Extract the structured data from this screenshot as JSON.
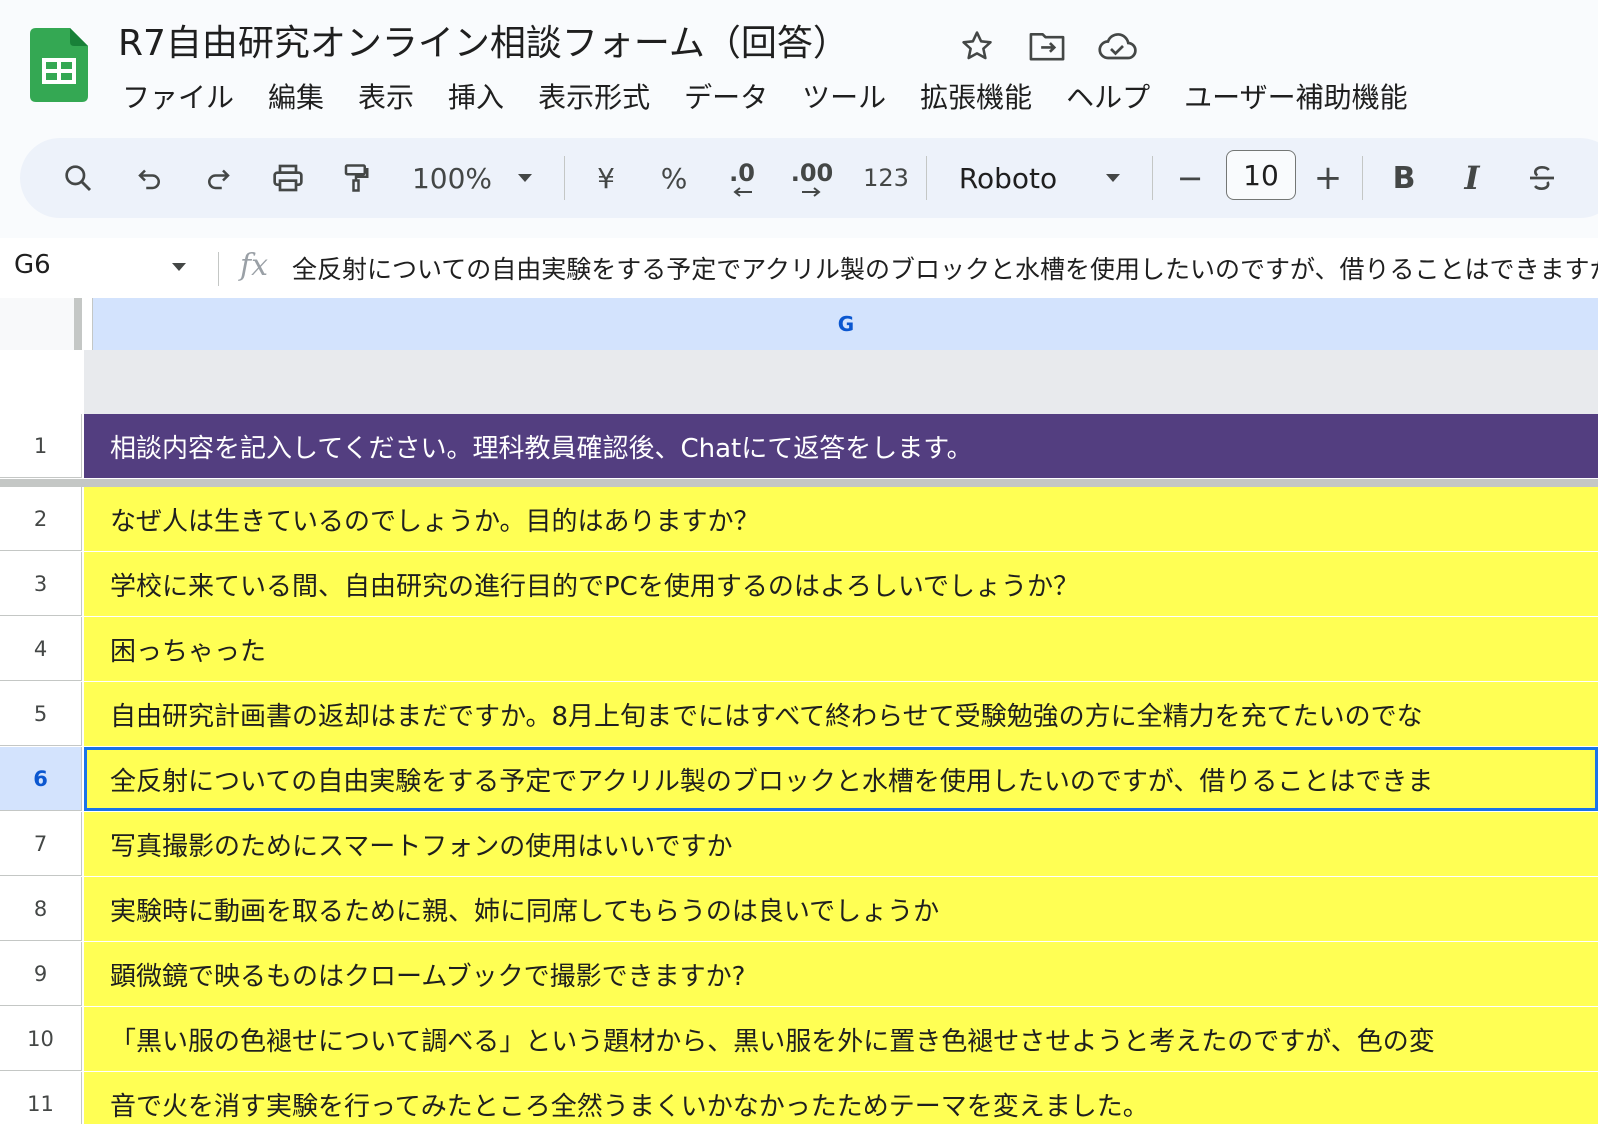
{
  "document": {
    "title": "R7自由研究オンライン相談フォーム（回答）"
  },
  "menu": [
    "ファイル",
    "編集",
    "表示",
    "挿入",
    "表示形式",
    "データ",
    "ツール",
    "拡張機能",
    "ヘルプ",
    "ユーザー補助機能"
  ],
  "toolbar": {
    "zoom": "100%",
    "currency": "¥",
    "percent": "%",
    "decrease_decimal": ".0",
    "increase_decimal": ".00",
    "number_format": "123",
    "font": "Roboto",
    "font_size": "10",
    "minus": "−",
    "plus": "+",
    "bold": "B",
    "italic": "I"
  },
  "formula_bar": {
    "cell_ref": "G6",
    "fx": "fx",
    "content": "全反射についての自由実験をする予定でアクリル製のブロックと水槽を使用したいのですが、借りることはできますか"
  },
  "grid": {
    "column": "G",
    "header_row": {
      "num": "1",
      "text": "相談内容を記入してください。理科教員確認後、Chatにて返答をします。"
    },
    "rows": [
      {
        "num": "2",
        "text": "なぜ人は生きているのでしょうか。目的はありますか？"
      },
      {
        "num": "3",
        "text": "学校に来ている間、自由研究の進行目的でPCを使用するのはよろしいでしょうか？"
      },
      {
        "num": "4",
        "text": "困っちゃった"
      },
      {
        "num": "5",
        "text": "自由研究計画書の返却はまだですか。8月上旬までにはすべて終わらせて受験勉強の方に全精力を充てたいのでな"
      },
      {
        "num": "6",
        "text": "全反射についての自由実験をする予定でアクリル製のブロックと水槽を使用したいのですが、借りることはできま"
      },
      {
        "num": "7",
        "text": "写真撮影のためにスマートフォンの使用はいいですか"
      },
      {
        "num": "8",
        "text": "実験時に動画を取るために親、姉に同席してもらうのは良いでしょうか"
      },
      {
        "num": "9",
        "text": "顕微鏡で映るものはクロームブックで撮影できますか?"
      },
      {
        "num": "10",
        "text": "「黒い服の色褪せについて調べる」という題材から、黒い服を外に置き色褪せさせようと考えたのですが、色の変"
      },
      {
        "num": "11",
        "text": "音で火を消す実験を行ってみたところ全然うまくいかなかったためテーマを変えました。"
      }
    ]
  },
  "colors": {
    "header_fill": "#533e80",
    "cell_fill": "#ffff54",
    "selection": "#1a73e8",
    "logo_green": "#34a853"
  }
}
